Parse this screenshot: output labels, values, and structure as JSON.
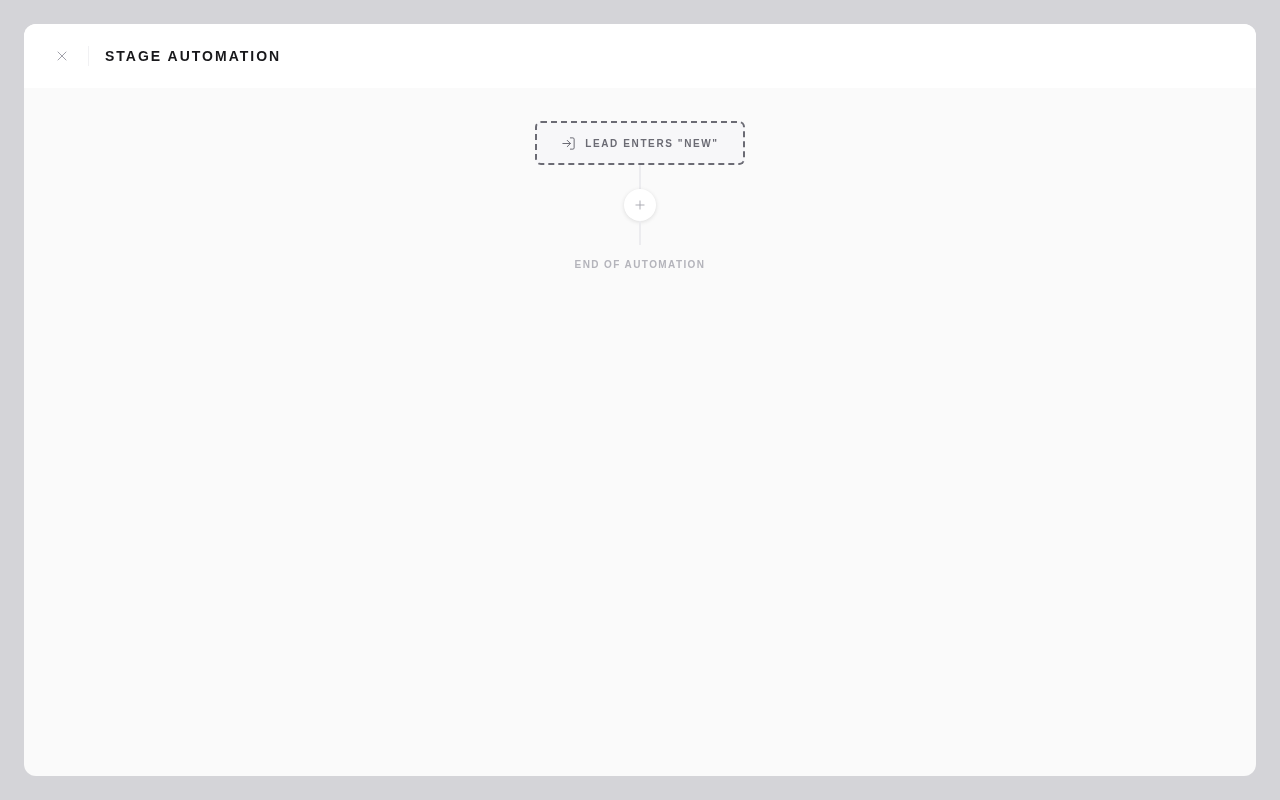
{
  "modal": {
    "title": "STAGE AUTOMATION"
  },
  "flow": {
    "trigger": {
      "label": "LEAD ENTERS \"NEW\""
    },
    "end_label": "END OF AUTOMATION"
  }
}
